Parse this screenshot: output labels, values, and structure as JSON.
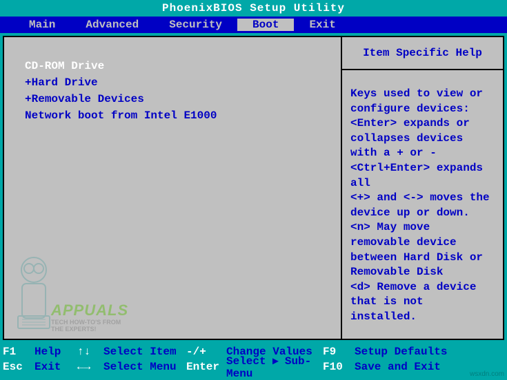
{
  "title": "PhoenixBIOS Setup Utility",
  "menu": {
    "items": [
      {
        "label": "Main"
      },
      {
        "label": "Advanced"
      },
      {
        "label": "Security"
      },
      {
        "label": "Boot"
      },
      {
        "label": "Exit"
      }
    ],
    "active_index": 3
  },
  "boot": {
    "items": [
      {
        "prefix": " ",
        "label": "CD-ROM Drive",
        "selected": true
      },
      {
        "prefix": "+",
        "label": "Hard Drive",
        "selected": false
      },
      {
        "prefix": "+",
        "label": "Removable Devices",
        "selected": false
      },
      {
        "prefix": " ",
        "label": "Network boot from Intel E1000",
        "selected": false
      }
    ]
  },
  "help": {
    "title": "Item Specific Help",
    "text": "Keys used to view or configure devices:\n<Enter> expands or collapses devices with a + or -\n<Ctrl+Enter> expands all\n<+> and <-> moves the device up or down.\n<n> May move removable device between Hard Disk or Removable Disk\n<d> Remove a device that is not installed."
  },
  "footer": {
    "row1": {
      "k1": "F1",
      "l1": "Help",
      "k2": "↑↓",
      "l2": "Select Item",
      "k3": "-/+",
      "l3": "Change Values",
      "k4": "F9",
      "l4": "Setup Defaults"
    },
    "row2": {
      "k1": "Esc",
      "l1": "Exit",
      "k2": "←→",
      "l2": "Select Menu",
      "k3": "Enter",
      "l3": "Select ▸ Sub-Menu",
      "k4": "F10",
      "l4": "Save and Exit"
    }
  },
  "watermark": {
    "title": "APPUALS",
    "sub1": "TECH HOW-TO'S FROM",
    "sub2": "THE EXPERTS!"
  },
  "attribution": "wsxdn.com"
}
